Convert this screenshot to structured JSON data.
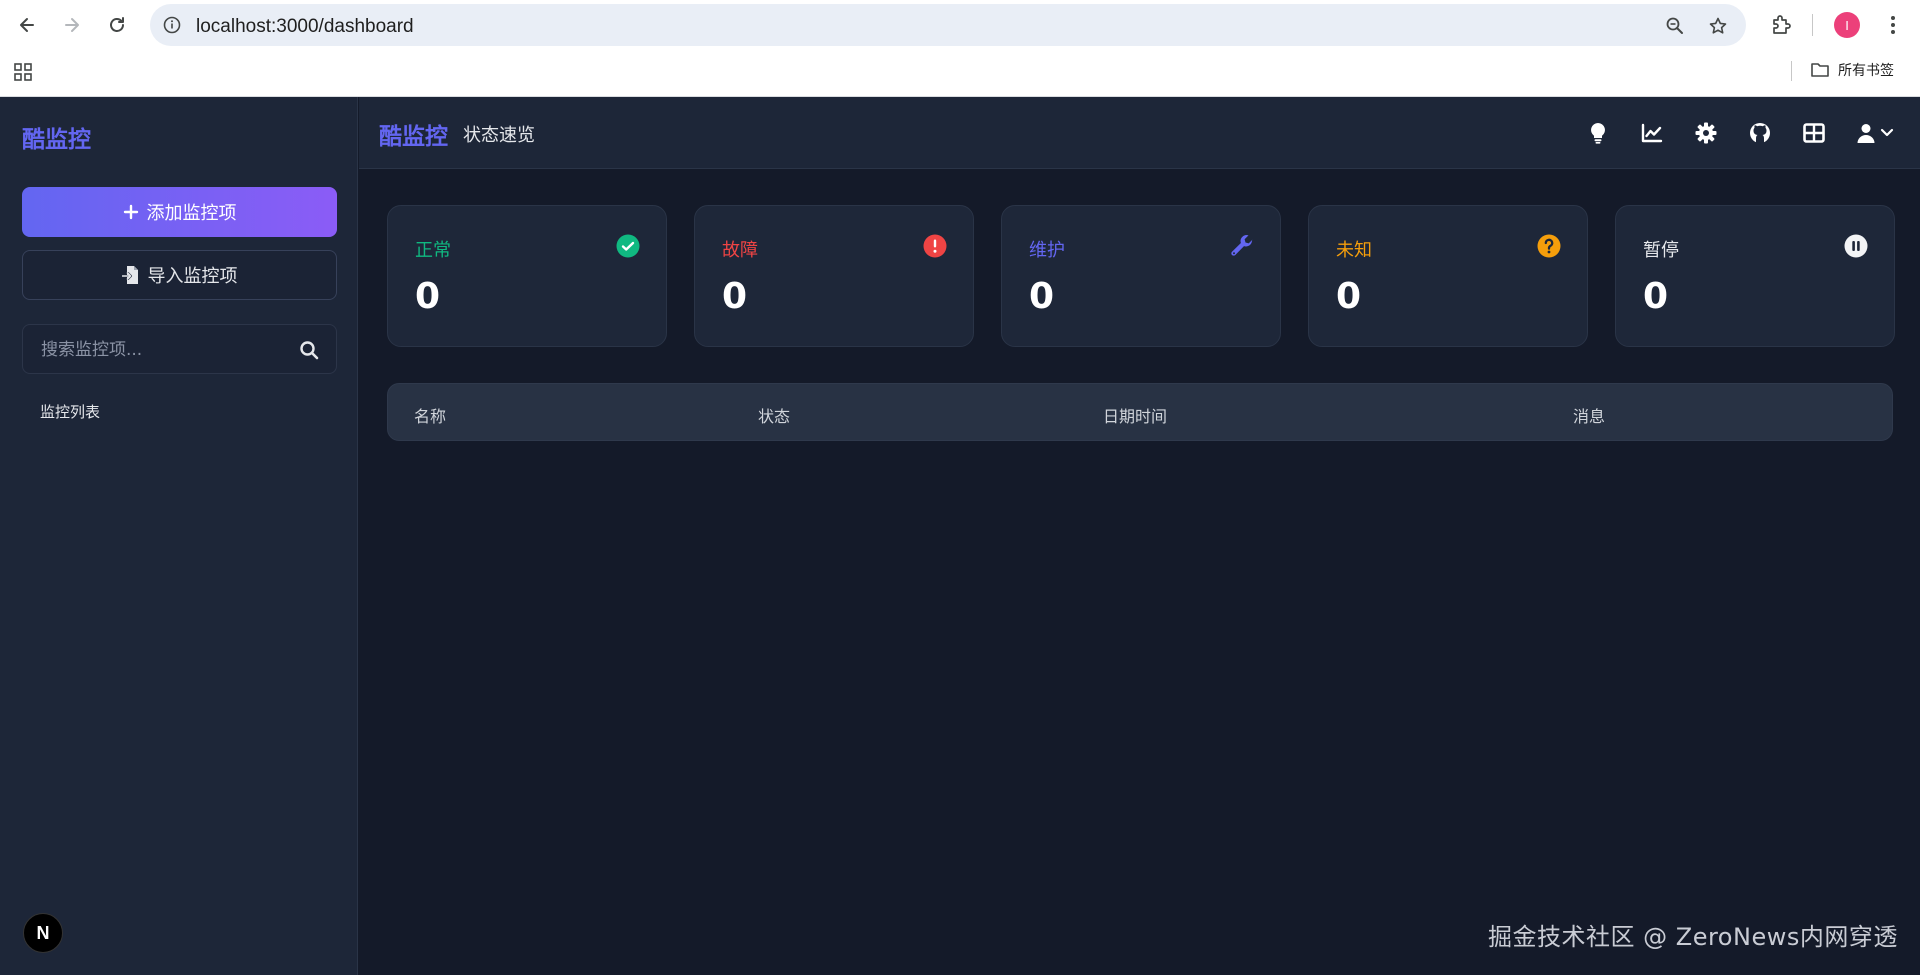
{
  "browser": {
    "url": "localhost:3000/dashboard",
    "profile_initial": "I",
    "bookmarks_folder": "所有书签"
  },
  "sidebar": {
    "logo": "酷监控",
    "add_button": "添加监控项",
    "import_button": "导入监控项",
    "search_placeholder": "搜索监控项...",
    "section_label": "监控列表",
    "framework_badge": "N"
  },
  "topbar": {
    "logo": "酷监控",
    "title": "状态速览",
    "icons": [
      "lightbulb-icon",
      "chart-line-icon",
      "gear-icon",
      "github-icon",
      "table-grid-icon",
      "user-icon",
      "chevron-down-icon"
    ]
  },
  "stats": [
    {
      "label": "正常",
      "value": "0",
      "color": "#10b981",
      "icon": "check-circle-icon"
    },
    {
      "label": "故障",
      "value": "0",
      "color": "#ef4444",
      "icon": "exclamation-circle-icon"
    },
    {
      "label": "维护",
      "value": "0",
      "color": "#6366f1",
      "icon": "wrench-icon"
    },
    {
      "label": "未知",
      "value": "0",
      "color": "#f59e0b",
      "icon": "question-circle-icon"
    },
    {
      "label": "暂停",
      "value": "0",
      "color": "#e5e7eb",
      "icon": "pause-circle-icon"
    }
  ],
  "table": {
    "columns": [
      "名称",
      "状态",
      "日期时间",
      "消息"
    ]
  },
  "watermark": "掘金技术社区 @ ZeroNews内网穿透"
}
